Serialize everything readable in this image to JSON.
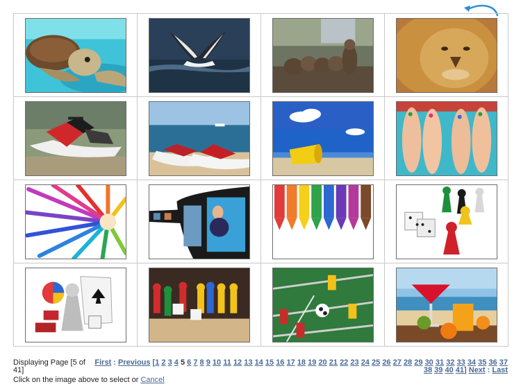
{
  "thumbnails": [
    {
      "label": "Sea turtle"
    },
    {
      "label": "Whale tail"
    },
    {
      "label": "Otters"
    },
    {
      "label": "Lion"
    },
    {
      "label": "Jet ski"
    },
    {
      "label": "Jet skis on beach"
    },
    {
      "label": "Yellow bucket on beach"
    },
    {
      "label": "Feet with painted toes"
    },
    {
      "label": "Colored pencils fan"
    },
    {
      "label": "Film strip"
    },
    {
      "label": "Crayons"
    },
    {
      "label": "Dice and game pawns"
    },
    {
      "label": "Games and cards"
    },
    {
      "label": "Board game pieces"
    },
    {
      "label": "Foosball table"
    },
    {
      "label": "Cocktails on beach"
    }
  ],
  "footer": {
    "display_text": "Displaying Page [5 of 41]",
    "first": "First",
    "sep1": " : ",
    "previous": "Previous",
    "bracket_open": " [",
    "pages": [
      "1",
      "2",
      "3",
      "4",
      "5",
      "6",
      "7",
      "8",
      "9",
      "10",
      "11",
      "12",
      "13",
      "14",
      "15",
      "16",
      "17",
      "18",
      "19",
      "20",
      "21",
      "22",
      "23",
      "24",
      "25",
      "26",
      "27",
      "28",
      "29",
      "30",
      "31",
      "32",
      "33",
      "34",
      "35",
      "36",
      "37",
      "38",
      "39",
      "40",
      "41"
    ],
    "current_page": "5",
    "bracket_close": "]",
    "next": "Next",
    "sep2": " : ",
    "last": "Last",
    "hint_text": "Click on the image above to select or ",
    "cancel": "Cancel"
  },
  "colors": {
    "link": "#4a6a94",
    "border": "#c8c8c8",
    "icon": "#2b8fd6"
  },
  "icons": {
    "rotate": "rotate-arrow-icon"
  }
}
